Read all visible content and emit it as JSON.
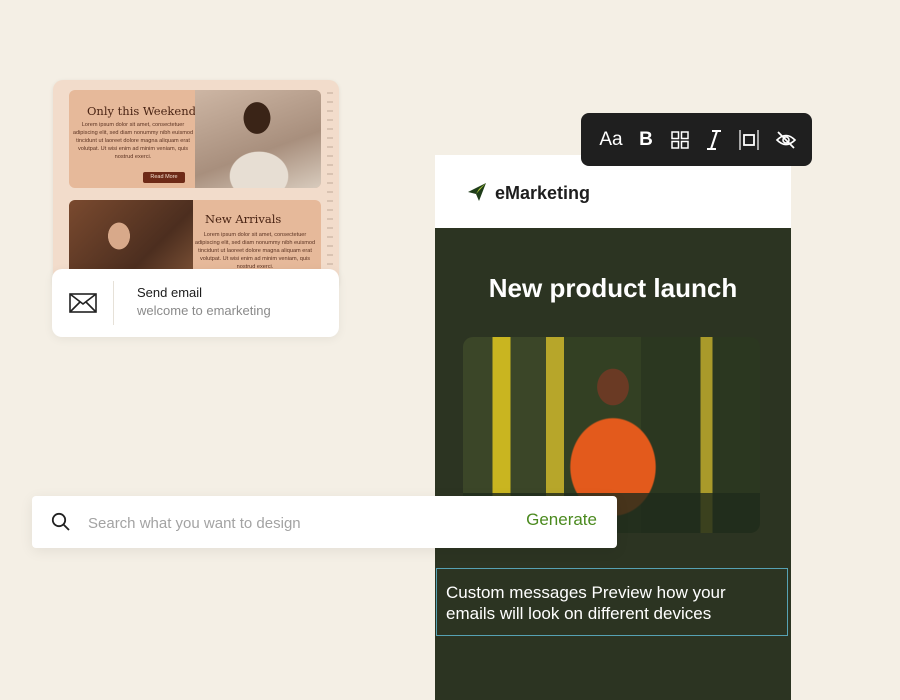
{
  "template_preview": {
    "promo_1": {
      "title": "Only this Weekend",
      "body": "Lorem ipsum dolor sit amet, consectetuer adipiscing elit, sed diam nonummy nibh euismod tincidunt ut laoreet dolore magna aliquam erat volutpat. Ut wisi enim ad minim veniam, quis nostrud exerci.",
      "button_label": "Read More"
    },
    "promo_2": {
      "title": "New Arrivals",
      "body": "Lorem ipsum dolor sit amet, consectetuer adipiscing elit, sed diam nonummy nibh euismod tincidunt ut laoreet dolore magna aliquam erat volutpat. Ut wisi enim ad minim veniam, quis nostrud exerci."
    }
  },
  "send_card": {
    "icon": "envelope-icon",
    "title": "Send email",
    "subtitle": "welcome to emarketing"
  },
  "phone": {
    "brand_name": "eMarketing",
    "headline": "New product launch",
    "caption": "Custom messages Preview how your emails will look on different devices",
    "colors": {
      "background": "#2c3422",
      "header": "#ffffff",
      "selection": "#56a1b3"
    }
  },
  "toolbar": {
    "items": [
      {
        "label": "Aa",
        "icon": "font-size-icon"
      },
      {
        "label": "B",
        "icon": "bold-icon"
      },
      {
        "icon": "grid-icon"
      },
      {
        "icon": "italic-icon"
      },
      {
        "icon": "frame-icon"
      },
      {
        "icon": "eye-off-icon"
      }
    ]
  },
  "search": {
    "placeholder": "Search what you want to design",
    "value": "",
    "generate_label": "Generate",
    "icon": "search-icon",
    "accent_color": "#4b8a1f"
  }
}
